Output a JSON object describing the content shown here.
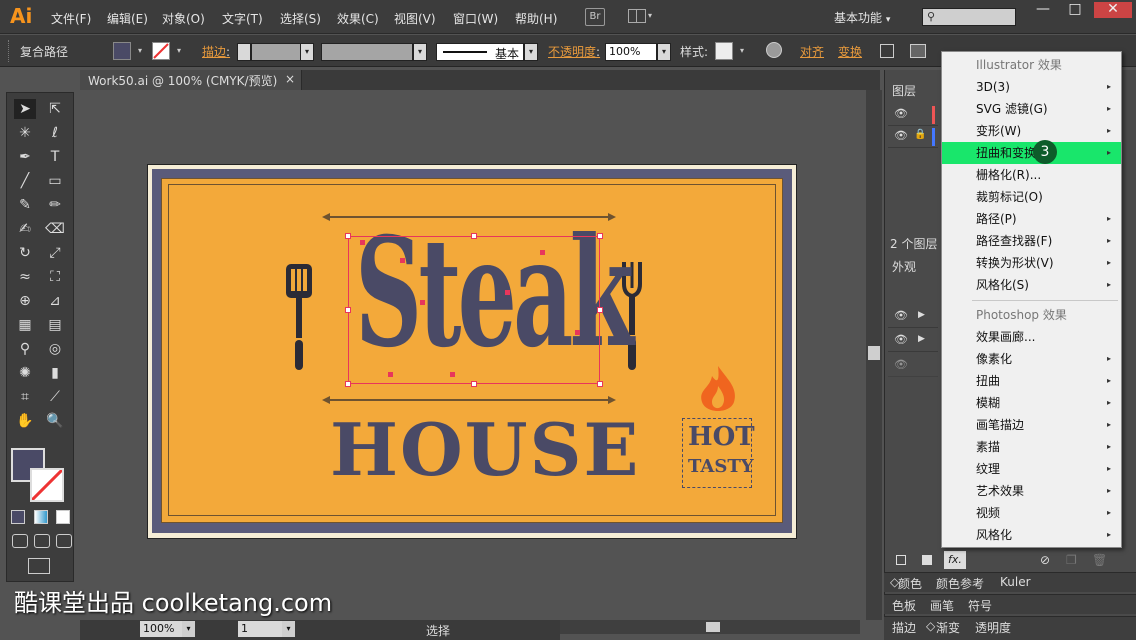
{
  "app": {
    "logo": "Ai",
    "workspace": "基本功能",
    "workspace_arrow": "▾",
    "bridge": "Br"
  },
  "menu": [
    "文件(F)",
    "编辑(E)",
    "对象(O)",
    "文字(T)",
    "选择(S)",
    "效果(C)",
    "视图(V)",
    "窗口(W)",
    "帮助(H)"
  ],
  "window_buttons": {
    "minimize": "—",
    "maximize": "□",
    "close": "✕"
  },
  "control": {
    "object_type": "复合路径",
    "stroke_label": "描边",
    "stroke_style": "基本",
    "opacity_label": "不透明度",
    "opacity_value": "100%",
    "style_label": "样式",
    "align_label": "对齐",
    "transform_label": "变换",
    "colon": ":"
  },
  "document": {
    "tab": "Work50.ai @ 100% (CMYK/预览)",
    "close": "×"
  },
  "artwork": {
    "word1": "Steak",
    "word2": "HOUSE",
    "badge1": "HOT",
    "badge2": "TASTY"
  },
  "status": {
    "zoom": "100%",
    "page": "1",
    "tool": "选择"
  },
  "panels": {
    "layers_tab": "图层",
    "layers_count": "2 个图层",
    "appearance_tab": "外观",
    "color_tabs": [
      "颜色",
      "颜色参考",
      "Kuler"
    ],
    "swatch_tabs": [
      "色板",
      "画笔",
      "符号"
    ],
    "stroke_tabs": [
      "描边",
      "渐变",
      "透明度"
    ],
    "fx_label": "fx."
  },
  "effect_menu": {
    "header1": "Illustrator 效果",
    "items1": [
      {
        "label": "3D(3)",
        "sub": true
      },
      {
        "label": "SVG 滤镜(G)",
        "sub": true
      },
      {
        "label": "变形(W)",
        "sub": true
      },
      {
        "label": "扭曲和变换",
        "sub": true,
        "highlighted": true
      },
      {
        "label": "栅格化(R)...",
        "sub": false
      },
      {
        "label": "裁剪标记(O)",
        "sub": false
      },
      {
        "label": "路径(P)",
        "sub": true
      },
      {
        "label": "路径查找器(F)",
        "sub": true
      },
      {
        "label": "转换为形状(V)",
        "sub": true
      },
      {
        "label": "风格化(S)",
        "sub": true
      }
    ],
    "header2": "Photoshop 效果",
    "items2": [
      {
        "label": "效果画廊...",
        "sub": false
      },
      {
        "label": "像素化",
        "sub": true
      },
      {
        "label": "扭曲",
        "sub": true
      },
      {
        "label": "模糊",
        "sub": true
      },
      {
        "label": "画笔描边",
        "sub": true
      },
      {
        "label": "素描",
        "sub": true
      },
      {
        "label": "纹理",
        "sub": true
      },
      {
        "label": "艺术效果",
        "sub": true
      },
      {
        "label": "视频",
        "sub": true
      },
      {
        "label": "风格化",
        "sub": true
      }
    ],
    "arrow": "▸"
  },
  "step_badge": "3",
  "watermark": "酷课堂出品 coolketang.com",
  "colors": {
    "accent": "#f7941d",
    "highlight": "#19e66b",
    "badge": "#0d5c2a",
    "card_orange": "#f3a93a",
    "card_navy": "#5a5b7a",
    "text_navy": "#4a4a66",
    "selection": "#e8365b"
  },
  "icons": [
    "selection-tool-icon",
    "direct-selection-icon",
    "magic-wand-icon",
    "lasso-icon",
    "pen-icon",
    "type-icon",
    "line-icon",
    "rectangle-icon",
    "paintbrush-icon",
    "pencil-icon",
    "blob-brush-icon",
    "eraser-icon",
    "rotate-icon",
    "scale-icon",
    "warp-icon",
    "free-transform-icon",
    "shape-builder-icon",
    "perspective-icon",
    "mesh-icon",
    "gradient-icon",
    "eyedropper-icon",
    "blend-icon",
    "symbol-sprayer-icon",
    "graph-icon",
    "artboard-icon",
    "slice-icon",
    "hand-icon",
    "zoom-icon"
  ]
}
